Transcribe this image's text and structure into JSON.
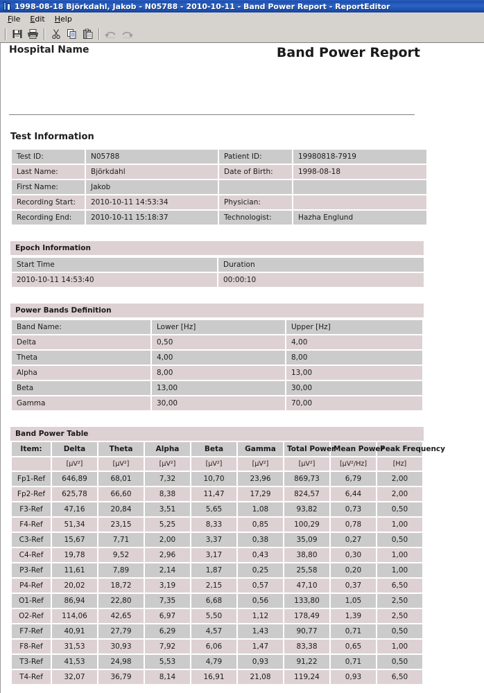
{
  "window": {
    "title": "1998-08-18 Björkdahl, Jakob - N05788 - 2010-10-11 - Band Power Report - ReportEditor",
    "menu": [
      {
        "label": "File",
        "accel": "F",
        "rest": "ile"
      },
      {
        "label": "Edit",
        "accel": "E",
        "rest": "dit"
      },
      {
        "label": "Help",
        "accel": "H",
        "rest": "elp"
      }
    ],
    "toolbar": [
      {
        "name": "save-button",
        "title": "Save"
      },
      {
        "name": "print-button",
        "title": "Print"
      },
      {
        "name": "cut-button",
        "title": "Cut"
      },
      {
        "name": "copy-button",
        "title": "Copy"
      },
      {
        "name": "paste-button",
        "title": "Paste"
      },
      {
        "name": "undo-button",
        "title": "Undo"
      },
      {
        "name": "redo-button",
        "title": "Redo"
      }
    ]
  },
  "report": {
    "hospital_name": "Hospital Name",
    "title": "Band Power Report"
  },
  "test_information": {
    "heading": "Test Information",
    "rows": [
      {
        "label1": "Test ID:",
        "value1": "N05788",
        "label2": "Patient ID:",
        "value2": "19980818-7919"
      },
      {
        "label1": "Last Name:",
        "value1": "Björkdahl",
        "label2": "Date of Birth:",
        "value2": "1998-08-18"
      },
      {
        "label1": "First Name:",
        "value1": "Jakob",
        "label2": "",
        "value2": ""
      },
      {
        "label1": "Recording Start:",
        "value1": "2010-10-11 14:53:34",
        "label2": "Physician:",
        "value2": ""
      },
      {
        "label1": "Recording End:",
        "value1": "2010-10-11 15:18:37",
        "label2": "Technologist:",
        "value2": "Hazha Englund"
      }
    ]
  },
  "epoch_information": {
    "heading": "Epoch Information",
    "columns": [
      "Start Time",
      "Duration"
    ],
    "rows": [
      [
        "2010-10-11 14:53:40",
        "00:00:10"
      ]
    ]
  },
  "power_bands_definition": {
    "heading": "Power Bands Definition",
    "columns": [
      "Band Name:",
      "Lower [Hz]",
      "Upper [Hz]"
    ],
    "rows": [
      [
        "Delta",
        "0,50",
        "4,00"
      ],
      [
        "Theta",
        "4,00",
        "8,00"
      ],
      [
        "Alpha",
        "8,00",
        "13,00"
      ],
      [
        "Beta",
        "13,00",
        "30,00"
      ],
      [
        "Gamma",
        "30,00",
        "70,00"
      ]
    ]
  },
  "band_power_table": {
    "heading": "Band Power Table",
    "columns": [
      "Item:",
      "Delta",
      "Theta",
      "Alpha",
      "Beta",
      "Gamma",
      "Total Power",
      "Mean Power",
      "Peak Frequency"
    ],
    "units": [
      "",
      "[µV²]",
      "[µV²]",
      "[µV²]",
      "[µV²]",
      "[µV²]",
      "[µV²]",
      "[µV²/Hz]",
      "[Hz]"
    ],
    "rows": [
      [
        "Fp1-Ref",
        "646,89",
        "68,01",
        "7,32",
        "10,70",
        "23,96",
        "869,73",
        "6,79",
        "2,00"
      ],
      [
        "Fp2-Ref",
        "625,78",
        "66,60",
        "8,38",
        "11,47",
        "17,29",
        "824,57",
        "6,44",
        "2,00"
      ],
      [
        "F3-Ref",
        "47,16",
        "20,84",
        "3,51",
        "5,65",
        "1,08",
        "93,82",
        "0,73",
        "0,50"
      ],
      [
        "F4-Ref",
        "51,34",
        "23,15",
        "5,25",
        "8,33",
        "0,85",
        "100,29",
        "0,78",
        "1,00"
      ],
      [
        "C3-Ref",
        "15,67",
        "7,71",
        "2,00",
        "3,37",
        "0,38",
        "35,09",
        "0,27",
        "0,50"
      ],
      [
        "C4-Ref",
        "19,78",
        "9,52",
        "2,96",
        "3,17",
        "0,43",
        "38,80",
        "0,30",
        "1,00"
      ],
      [
        "P3-Ref",
        "11,61",
        "7,89",
        "2,14",
        "1,87",
        "0,25",
        "25,58",
        "0,20",
        "1,00"
      ],
      [
        "P4-Ref",
        "20,02",
        "18,72",
        "3,19",
        "2,15",
        "0,57",
        "47,10",
        "0,37",
        "6,50"
      ],
      [
        "O1-Ref",
        "86,94",
        "22,80",
        "7,35",
        "6,68",
        "0,56",
        "133,80",
        "1,05",
        "2,50"
      ],
      [
        "O2-Ref",
        "114,06",
        "42,65",
        "6,97",
        "5,50",
        "1,12",
        "178,49",
        "1,39",
        "2,50"
      ],
      [
        "F7-Ref",
        "40,91",
        "27,79",
        "6,29",
        "4,57",
        "1,43",
        "90,77",
        "0,71",
        "0,50"
      ],
      [
        "F8-Ref",
        "31,53",
        "30,93",
        "7,92",
        "6,06",
        "1,47",
        "83,38",
        "0,65",
        "1,00"
      ],
      [
        "T3-Ref",
        "41,53",
        "24,98",
        "5,53",
        "4,79",
        "0,93",
        "91,22",
        "0,71",
        "0,50"
      ],
      [
        "T4-Ref",
        "32,07",
        "36,79",
        "8,14",
        "16,91",
        "21,08",
        "119,24",
        "0,93",
        "6,50"
      ]
    ]
  },
  "colors": {
    "titlebar_blue": "#1f4fae",
    "chrome_gray": "#d6d3ce",
    "row_gray": "#cbcbcb",
    "row_pink": "#ddd1d3"
  }
}
